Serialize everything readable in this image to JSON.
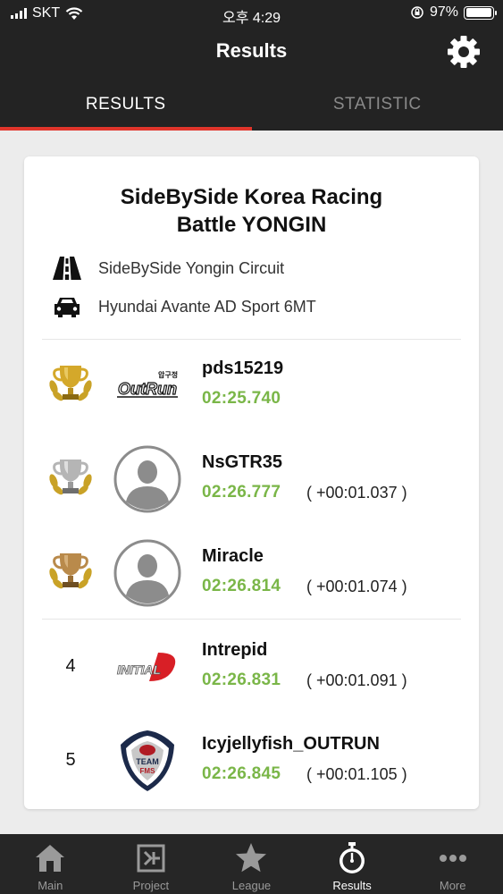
{
  "status_bar": {
    "carrier": "SKT",
    "time": "오후 4:29",
    "battery": "97%"
  },
  "header": {
    "title": "Results"
  },
  "tabs": [
    {
      "label": "RESULTS",
      "active": true
    },
    {
      "label": "STATISTIC",
      "active": false
    }
  ],
  "event": {
    "title_line1": "SideBySide Korea Racing",
    "title_line2": "Battle YONGIN",
    "circuit": "SideBySide Yongin Circuit",
    "car": "Hyundai Avante AD Sport 6MT"
  },
  "results": [
    {
      "rank": "1",
      "trophy": "gold-trophy-icon",
      "logo": "outrun-team-logo",
      "logo_text": "OutRun",
      "logo_subtext": "압구정",
      "name": "pds15219",
      "time": "02:25.740",
      "gap": ""
    },
    {
      "rank": "2",
      "trophy": "silver-trophy-icon",
      "logo": "default-avatar",
      "name": "NsGTR35",
      "time": "02:26.777",
      "gap": "( +00:01.037 )"
    },
    {
      "rank": "3",
      "trophy": "bronze-trophy-icon",
      "logo": "default-avatar",
      "name": "Miracle",
      "time": "02:26.814",
      "gap": "( +00:01.074 )"
    },
    {
      "rank": "4",
      "logo": "initial-d-logo",
      "logo_text": "INITIAL",
      "logo_text2": "D",
      "name": "Intrepid",
      "time": "02:26.831",
      "gap": "( +00:01.091 )"
    },
    {
      "rank": "5",
      "logo": "team-fms-emblem",
      "logo_text": "TEAM",
      "logo_text2": "FMS",
      "name": "Icyjellyfish_OUTRUN",
      "time": "02:26.845",
      "gap": "( +00:01.105 )"
    }
  ],
  "bottom_nav": [
    {
      "label": "Main",
      "icon": "home-icon",
      "active": false
    },
    {
      "label": "Project",
      "icon": "project-icon",
      "active": false
    },
    {
      "label": "League",
      "icon": "star-icon",
      "active": false
    },
    {
      "label": "Results",
      "icon": "stopwatch-icon",
      "active": true
    },
    {
      "label": "More",
      "icon": "more-dots-icon",
      "active": false
    }
  ],
  "colors": {
    "header_bg": "#232323",
    "accent_red": "#e0352b",
    "time_green": "#7ab648",
    "gold": "#c9a227",
    "silver": "#b5b5b5",
    "bronze": "#b98a4b"
  }
}
